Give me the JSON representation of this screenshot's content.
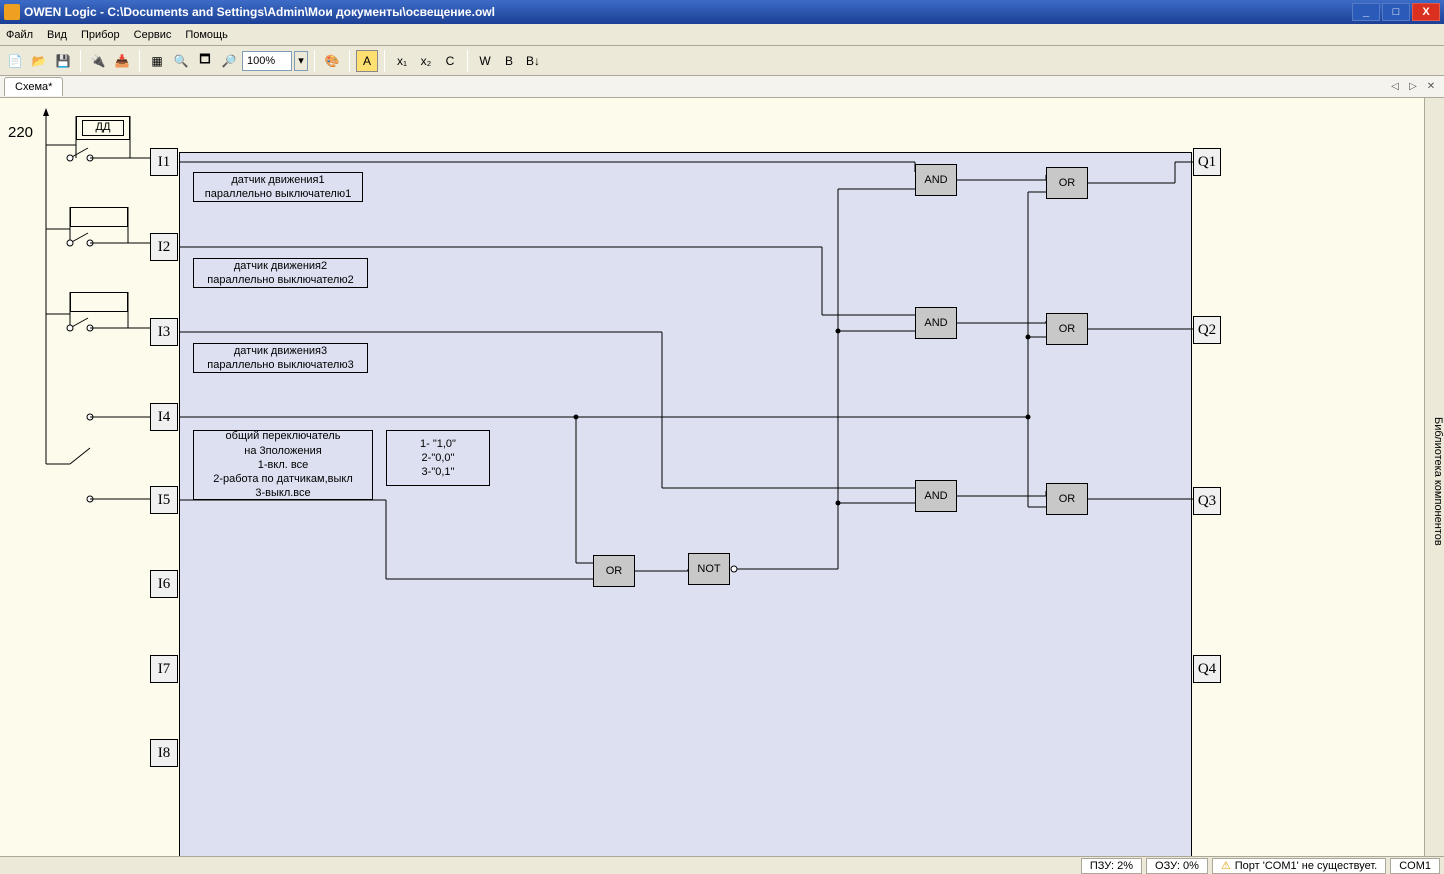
{
  "title": "OWEN Logic - C:\\Documents and Settings\\Admin\\Мои документы\\освещение.owl",
  "menu": {
    "file": "Файл",
    "view": "Вид",
    "device": "Прибор",
    "service": "Сервис",
    "help": "Помощь"
  },
  "toolbar": {
    "zoom": "100%"
  },
  "tab": "Схема*",
  "side_panel": "Библиотека компонентов",
  "canvas": {
    "v220": "220",
    "dd": "ДД",
    "inputs": [
      "I1",
      "I2",
      "I3",
      "I4",
      "I5",
      "I6",
      "I7",
      "I8"
    ],
    "outputs": [
      "Q1",
      "Q2",
      "Q3",
      "Q4"
    ],
    "gates": {
      "and": "AND",
      "or": "OR",
      "not": "NOT"
    },
    "comment1a": "датчик движения1",
    "comment1b": "параллельно выключателю1",
    "comment2a": "датчик движения2",
    "comment2b": "параллельно выключателю2",
    "comment3a": "датчик движения3",
    "comment3b": "параллельно выключателю3",
    "comment4a": "общий переключатель",
    "comment4b": "на 3положения",
    "comment4c": "1-вкл. все",
    "comment4d": "2-работа по датчикам,выкл",
    "comment4e": "3-выкл.все",
    "legend1": "1-  \"1,0\"",
    "legend2": "2-\"0,0\"",
    "legend3": "3-\"0,1\""
  },
  "status": {
    "pzu": "ПЗУ: 2%",
    "ozu": "ОЗУ: 0%",
    "port": "Порт 'COM1' не существует.",
    "com": "COM1"
  }
}
